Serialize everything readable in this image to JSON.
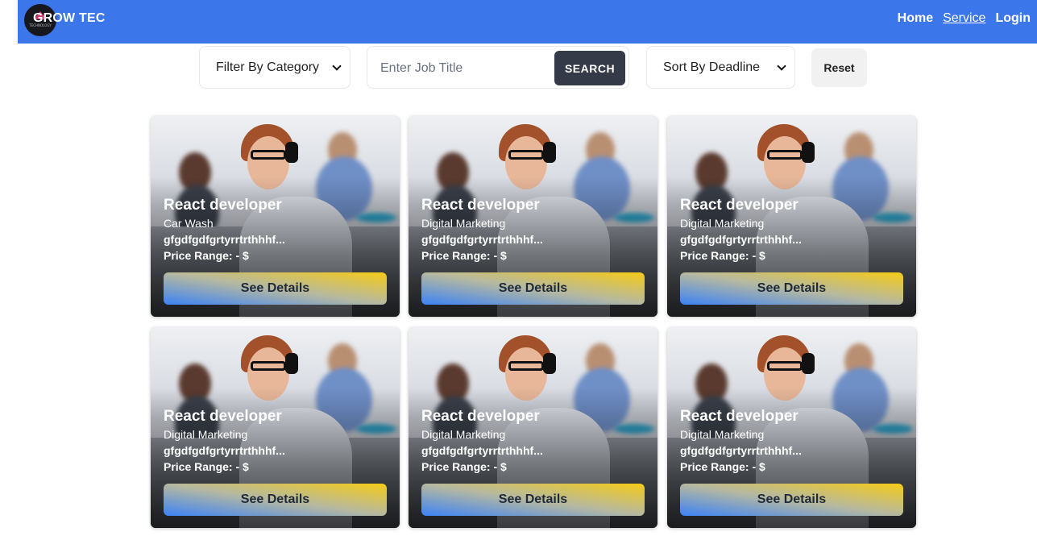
{
  "nav": {
    "brand": "GROW TEC",
    "logo_text": "TECHNOLOGY",
    "links": [
      "Home",
      "Service",
      "Login"
    ]
  },
  "filters": {
    "category_select": "Filter By Category",
    "search_placeholder": "Enter Job Title",
    "search_button": "SEARCH",
    "sort_select": "Sort By Deadline",
    "reset_button": "Reset"
  },
  "jobs": [
    {
      "title": "React developer",
      "category": "Car Wash",
      "description": "gfgdfgdfgrtyrrtrthhhf...",
      "price": "Price Range: - $",
      "button": "See Details"
    },
    {
      "title": "React developer",
      "category": "Digital Marketing",
      "description": "gfgdfgdfgrtyrrtrthhhf...",
      "price": "Price Range: - $",
      "button": "See Details"
    },
    {
      "title": "React developer",
      "category": "Digital Marketing",
      "description": "gfgdfgdfgrtyrrtrthhhf...",
      "price": "Price Range: - $",
      "button": "See Details"
    },
    {
      "title": "React developer",
      "category": "Digital Marketing",
      "description": "gfgdfgdfgrtyrrtrthhhf...",
      "price": "Price Range: - $",
      "button": "See Details"
    },
    {
      "title": "React developer",
      "category": "Digital Marketing",
      "description": "gfgdfgdfgrtyrrtrthhhf...",
      "price": "Price Range: - $",
      "button": "See Details"
    },
    {
      "title": "React developer",
      "category": "Digital Marketing",
      "description": "gfgdfgdfgrtyrrtrthhhf...",
      "price": "Price Range: - $",
      "button": "See Details"
    }
  ],
  "colors": {
    "navbar": "#3b76ea",
    "search_button": "#343a47",
    "details_gradient_start": "#3b82f6",
    "details_gradient_end": "#f5cb16"
  }
}
